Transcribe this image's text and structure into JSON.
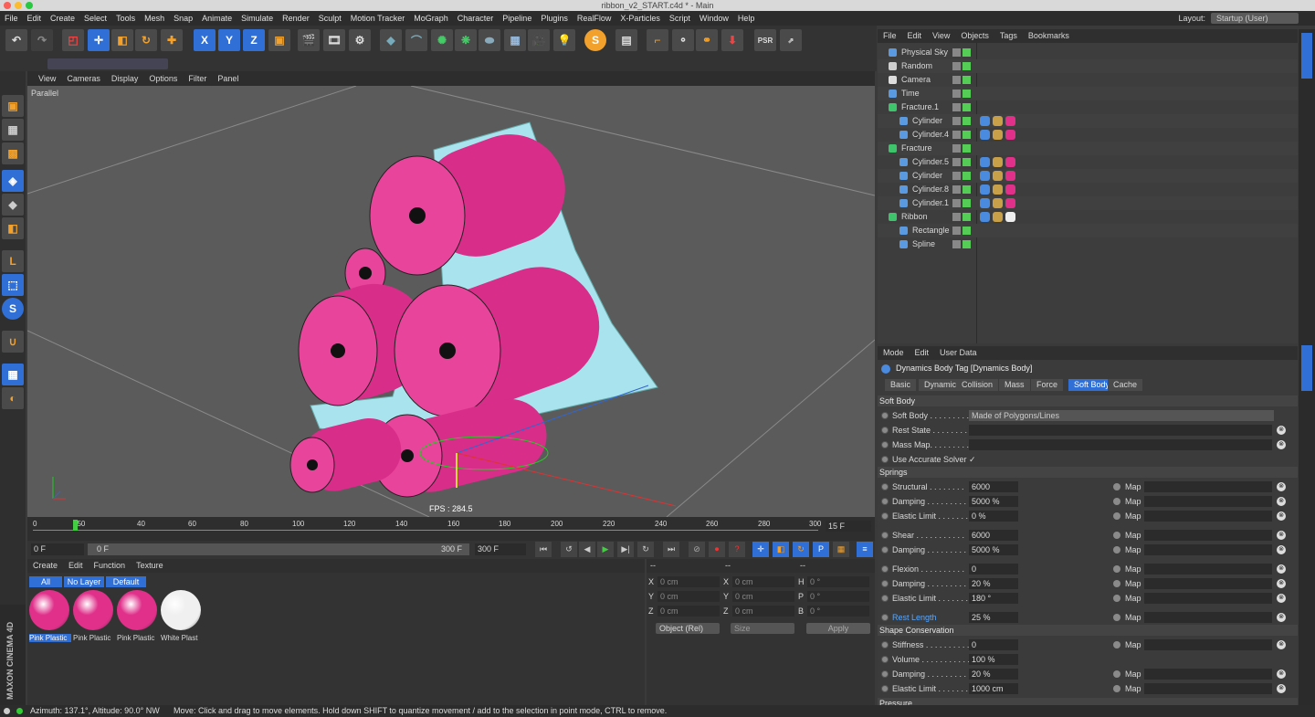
{
  "window_title": "ribbon_v2_START.c4d * - Main",
  "menubar": [
    "File",
    "Edit",
    "Create",
    "Select",
    "Tools",
    "Mesh",
    "Snap",
    "Animate",
    "Simulate",
    "Render",
    "Sculpt",
    "Motion Tracker",
    "MoGraph",
    "Character",
    "Pipeline",
    "Plugins",
    "RealFlow",
    "X-Particles",
    "Script",
    "Window",
    "Help"
  ],
  "layout": {
    "label": "Layout:",
    "value": "Startup (User)"
  },
  "viewport": {
    "menu": [
      "View",
      "Cameras",
      "Display",
      "Options",
      "Filter",
      "Panel"
    ],
    "projection": "Parallel",
    "fps": "FPS : 284.5"
  },
  "timeline": {
    "ticks": [
      "0",
      "150",
      "40",
      "60",
      "80",
      "100",
      "120",
      "140",
      "160",
      "180",
      "200",
      "220",
      "240",
      "260",
      "280",
      "300"
    ],
    "frame_display": "15 F",
    "start_field": "0 F",
    "range_start": "0 F",
    "range_end": "300 F",
    "end_field": "300 F"
  },
  "materials": {
    "menu": [
      "Create",
      "Edit",
      "Function",
      "Texture"
    ],
    "filters": [
      "All",
      "No Layer",
      "Default"
    ],
    "items": [
      {
        "name": "Pink Plastic",
        "color": "#e0308a"
      },
      {
        "name": "Pink Plastic",
        "color": "#e0308a"
      },
      {
        "name": "Pink Plastic",
        "color": "#e0308a"
      },
      {
        "name": "White Plast",
        "color": "#f0f0f0"
      }
    ]
  },
  "coords": {
    "headers": [
      "--",
      "--",
      "--"
    ],
    "rows": [
      {
        "a": "X",
        "av": "0 cm",
        "b": "X",
        "bv": "0 cm",
        "c": "H",
        "cv": "0 °"
      },
      {
        "a": "Y",
        "av": "0 cm",
        "b": "Y",
        "bv": "0 cm",
        "c": "P",
        "cv": "0 °"
      },
      {
        "a": "Z",
        "av": "0 cm",
        "b": "Z",
        "bv": "0 cm",
        "c": "B",
        "cv": "0 °"
      }
    ],
    "mode": "Object (Rel)",
    "size": "Size",
    "apply": "Apply"
  },
  "object_manager": {
    "menu": [
      "File",
      "Edit",
      "View",
      "Objects",
      "Tags",
      "Bookmarks"
    ],
    "objects": [
      {
        "name": "Physical Sky",
        "indent": 0,
        "icon": "sky-icon"
      },
      {
        "name": "Random",
        "indent": 0,
        "icon": "random-icon"
      },
      {
        "name": "Camera",
        "indent": 0,
        "icon": "camera-icon"
      },
      {
        "name": "Time",
        "indent": 0,
        "icon": "time-icon"
      },
      {
        "name": "Fracture.1",
        "indent": 0,
        "icon": "fracture-icon"
      },
      {
        "name": "Cylinder",
        "indent": 1,
        "icon": "cylinder-icon"
      },
      {
        "name": "Cylinder.4",
        "indent": 1,
        "icon": "cylinder-icon"
      },
      {
        "name": "Fracture",
        "indent": 0,
        "icon": "fracture-icon"
      },
      {
        "name": "Cylinder.5",
        "indent": 1,
        "icon": "cylinder-icon"
      },
      {
        "name": "Cylinder",
        "indent": 1,
        "icon": "cylinder-icon"
      },
      {
        "name": "Cylinder.8",
        "indent": 1,
        "icon": "cylinder-icon"
      },
      {
        "name": "Cylinder.1",
        "indent": 1,
        "icon": "cylinder-icon"
      },
      {
        "name": "Ribbon",
        "indent": 0,
        "icon": "ribbon-icon"
      },
      {
        "name": "Rectangle",
        "indent": 1,
        "icon": "rectangle-icon"
      },
      {
        "name": "Spline",
        "indent": 1,
        "icon": "spline-icon"
      }
    ]
  },
  "attributes": {
    "menu": [
      "Mode",
      "Edit",
      "User Data"
    ],
    "header": "Dynamics Body Tag [Dynamics Body]",
    "tabs": [
      "Basic",
      "Dynamics",
      "Collision",
      "Mass",
      "Force",
      "Soft Body",
      "Cache"
    ],
    "active_tab": "Soft Body",
    "soft_body_section": "Soft Body",
    "soft_body_rows": [
      {
        "label": "Soft Body . . . . . . . . .",
        "value": "Made of Polygons/Lines"
      },
      {
        "label": "Rest State . . . . . . . .",
        "value": ""
      },
      {
        "label": "Mass Map. . . . . . . . . .",
        "value": ""
      },
      {
        "label": "Use Accurate Solver",
        "value": "✓"
      }
    ],
    "springs_section": "Springs",
    "springs_rows": [
      {
        "label": "Structural . . . . . . . .",
        "value": "6000",
        "map": "Map"
      },
      {
        "label": "Damping . . . . . . . . .",
        "value": "5000 %",
        "map": "Map"
      },
      {
        "label": "Elastic Limit . . . . . . .",
        "value": "0 %",
        "map": "Map"
      },
      {
        "label": "Shear . . . . . . . . . . .",
        "value": "6000",
        "map": "Map"
      },
      {
        "label": "Damping . . . . . . . . .",
        "value": "5000 %",
        "map": "Map"
      },
      {
        "label": "Flexion . . . . . . . . . .",
        "value": "0",
        "map": "Map"
      },
      {
        "label": "Damping . . . . . . . . .",
        "value": "20 %",
        "map": "Map"
      },
      {
        "label": "Elastic Limit . . . . . . .",
        "value": "180 °",
        "map": "Map"
      },
      {
        "label": "Rest Length",
        "value": "25 %",
        "map": "Map"
      }
    ],
    "shape_section": "Shape Conservation",
    "shape_rows": [
      {
        "label": "Stiffness . . . . . . . . . .",
        "value": "0",
        "map": "Map"
      },
      {
        "label": "Volume . . . . . . . . . . .",
        "value": "100 %",
        "map": ""
      },
      {
        "label": "Damping . . . . . . . . .",
        "value": "20 %",
        "map": "Map"
      },
      {
        "label": "Elastic Limit . . . . . . .",
        "value": "1000 cm",
        "map": "Map"
      }
    ],
    "pressure_section": "Pressure"
  },
  "status": {
    "azimuth": "Azimuth: 137.1°, Altitude: 90.0°  NW",
    "message": "Move: Click and drag to move elements. Hold down SHIFT to quantize movement / add to the selection in point mode, CTRL to remove."
  },
  "brand": "MAXON CINEMA 4D",
  "colors": {
    "accent": "#2f6fd6",
    "magenta": "#e0308a",
    "ribbon": "#a9e4ee"
  }
}
